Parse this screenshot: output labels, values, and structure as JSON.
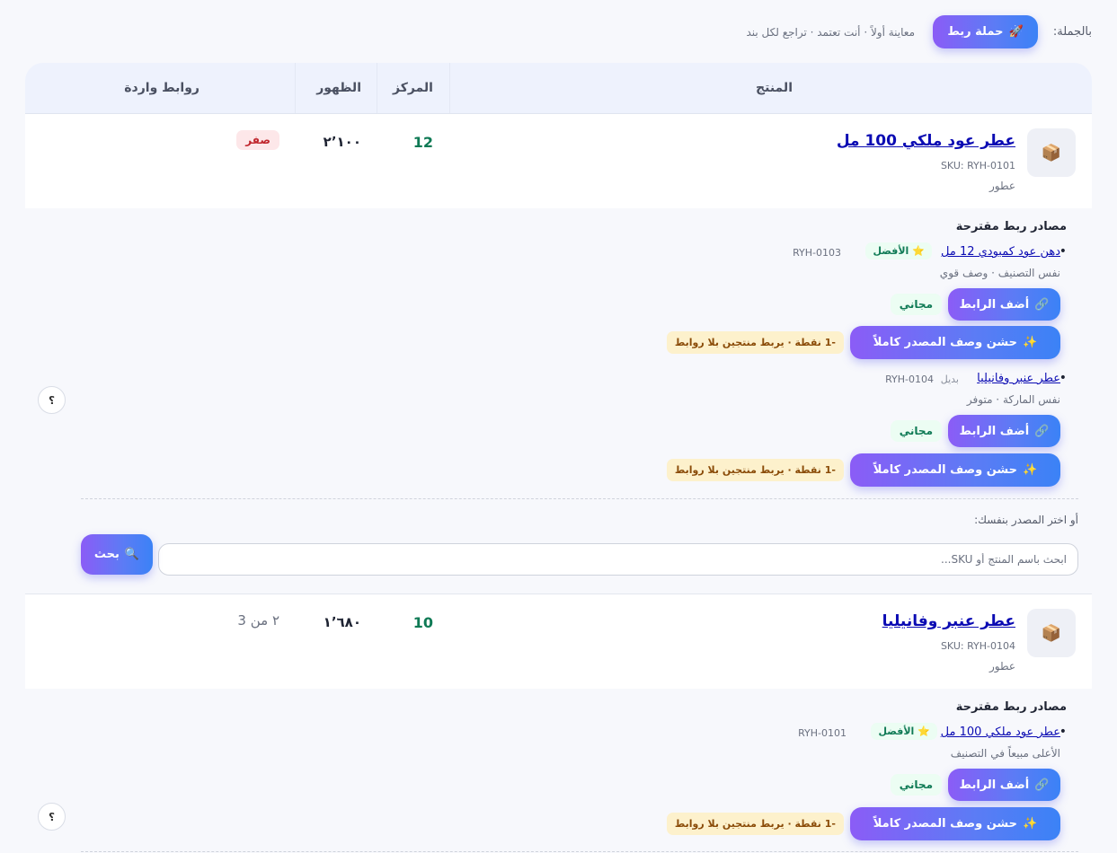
{
  "topbar": {
    "bulk_label": "بالجملة:",
    "campaign_button": "حملة ربط",
    "campaign_icon": "rocket-icon",
    "hint": "معاينة أولاً · أنت تعتمد · تراجع لكل بند"
  },
  "table": {
    "headers": {
      "product": "المنتج",
      "rank": "المركز",
      "views": "الظهور",
      "inbound": "روابط واردة"
    }
  },
  "products": [
    {
      "name": "عطر عود ملكي 100 مل",
      "sku": "SKU: RYH-0101",
      "category": "عطور",
      "rank": "12",
      "views": "٢٬١٠٠",
      "inbound": "صفر",
      "suggestions_title": "مصادر ربط مقترحة",
      "suggestions": [
        {
          "name": "دهن عود كمبودي 12 مل",
          "tag": "الأفضل",
          "sku": "RYH-0103",
          "reason": "نفس التصنيف · وصف قوي",
          "add_label": "أضف الرابط",
          "free_label": "مجاني",
          "fill_label": "حشن وصف المصدر كاملاً",
          "cost_label": "-1 نقطة · يربط منتجين بلا روابط"
        },
        {
          "name": "عطر عنبر وفانيليا",
          "tag": "بديل",
          "sku": "RYH-0104",
          "reason": "نفس الماركة · متوفر",
          "add_label": "أضف الرابط",
          "free_label": "مجاني",
          "fill_label": "حشن وصف المصدر كاملاً",
          "cost_label": "-1 نقطة · يربط منتجين بلا روابط"
        }
      ],
      "manual_label": "أو اختر المصدر بنفسك:",
      "search_placeholder": "ابحث باسم المنتج أو SKU...",
      "search_button": "بحث",
      "help": "؟"
    },
    {
      "name": "عطر عنبر وفانيليا",
      "sku": "SKU: RYH-0104",
      "category": "عطور",
      "rank": "10",
      "views": "١٬٦٨٠",
      "inbound": "٢ من 3",
      "suggestions_title": "مصادر ربط مقترحة",
      "suggestions": [
        {
          "name": "عطر عود ملكي 100 مل",
          "tag": "الأفضل",
          "sku": "RYH-0101",
          "reason": "الأعلى مبيعاً في التصنيف",
          "add_label": "أضف الرابط",
          "free_label": "مجاني",
          "fill_label": "حشن وصف المصدر كاملاً",
          "cost_label": "-1 نقطة · يربط منتجين بلا روابط"
        }
      ],
      "help": "؟"
    }
  ],
  "icons": {
    "thumb": "package-icon",
    "best": "star-icon",
    "add": "link-icon",
    "fill": "sparkles-icon",
    "search": "magnifier-icon"
  },
  "colors": {
    "accent_start": "#8b5cf6",
    "accent_end": "#3b82f6",
    "rank_green": "#0f7a55",
    "zero_red": "#c0262d",
    "link_blue": "#0b0bb3"
  }
}
